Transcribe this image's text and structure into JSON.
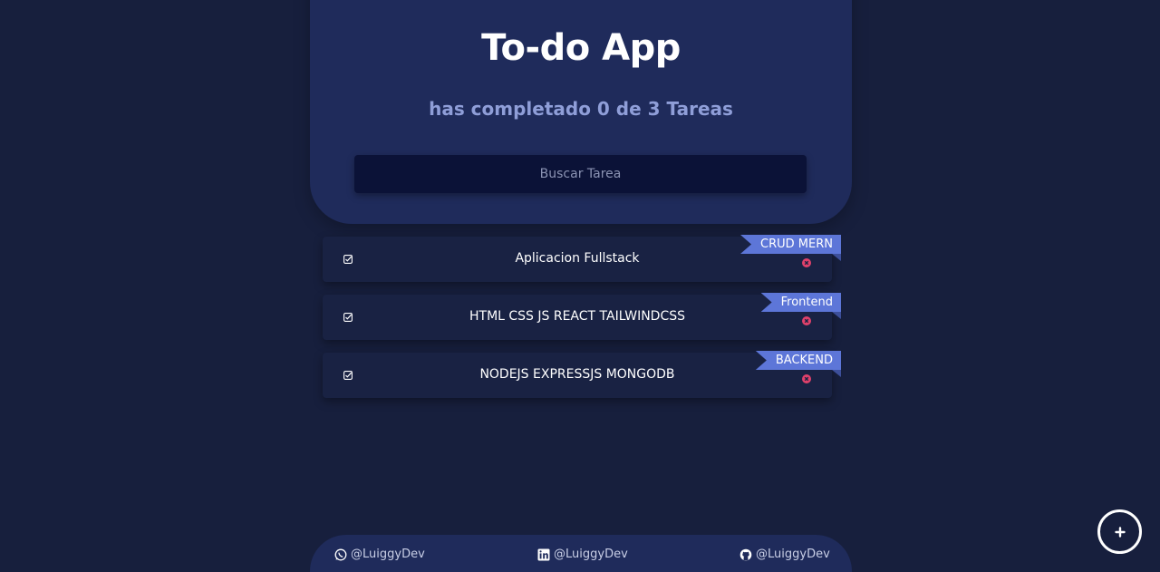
{
  "header": {
    "title": "To-do App",
    "subtitle": "has completado 0 de 3 Tareas"
  },
  "search": {
    "placeholder": "Buscar Tarea",
    "value": ""
  },
  "tasks": [
    {
      "text": "Aplicacion Fullstack",
      "tag": "CRUD MERN",
      "completed": false
    },
    {
      "text": "HTML CSS JS REACT TAILWINDCSS",
      "tag": "Frontend",
      "completed": false
    },
    {
      "text": "NODEJS EXPRESSJS MONGODB",
      "tag": "BACKEND",
      "completed": false
    }
  ],
  "footer": {
    "links": [
      {
        "icon": "whatsapp-icon",
        "label": "@LuiggyDev"
      },
      {
        "icon": "linkedin-icon",
        "label": "@LuiggyDev"
      },
      {
        "icon": "github-icon",
        "label": "@LuiggyDev"
      }
    ]
  },
  "add_button": {
    "icon": "plus-icon"
  },
  "colors": {
    "background": "#171f3d",
    "card": "#1f2b5b",
    "accent": "#5d76d8",
    "subtitle": "#8f9ed8",
    "delete": "#e0416b"
  }
}
